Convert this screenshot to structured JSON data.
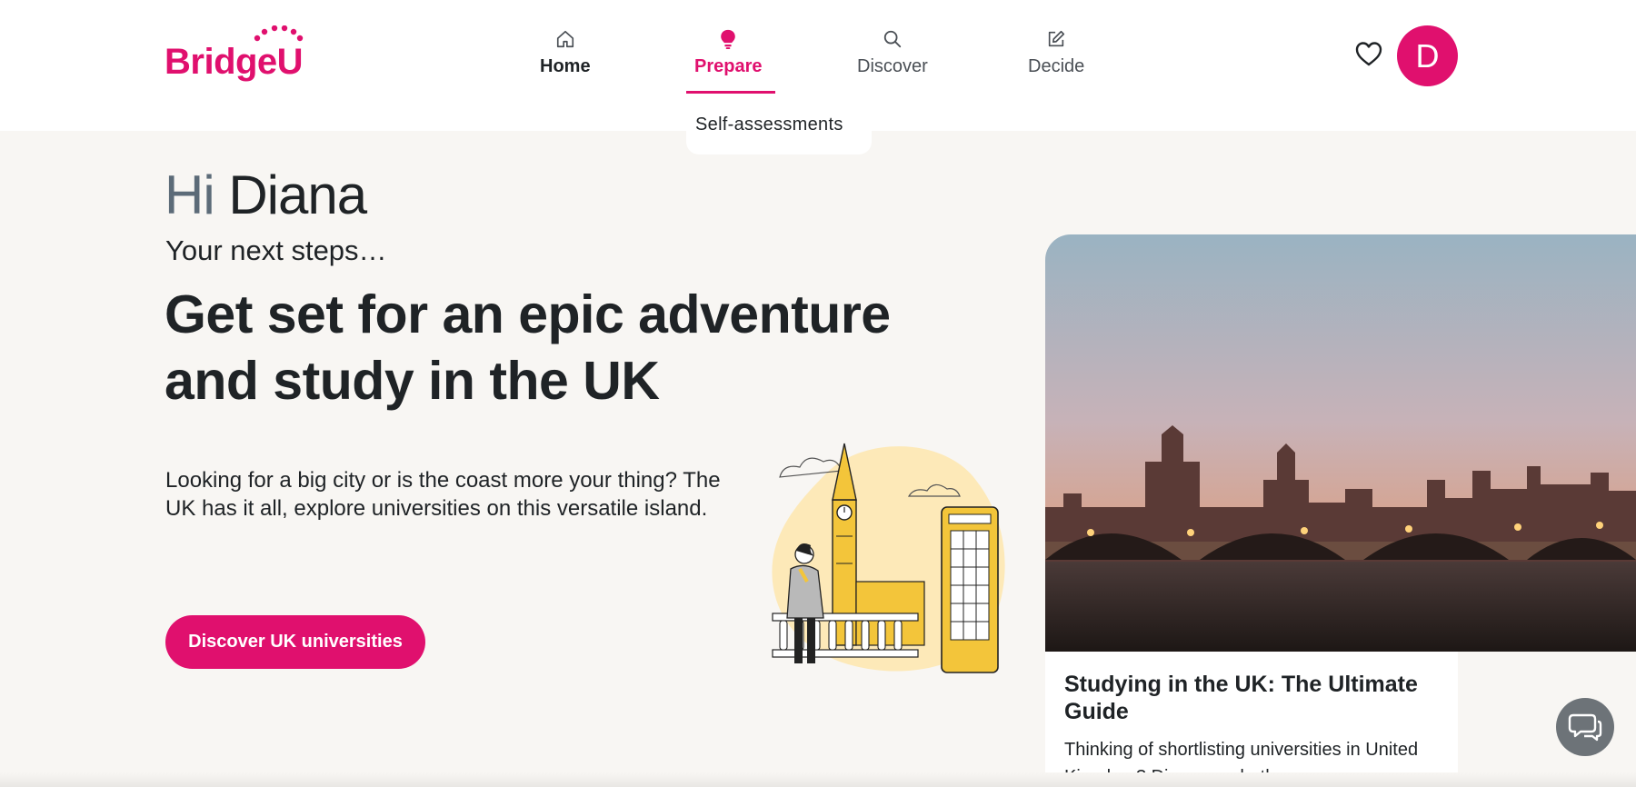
{
  "brand": {
    "name": "BridgeU",
    "color": "#e0106e"
  },
  "nav": {
    "items": [
      {
        "label": "Home",
        "icon": "home-icon"
      },
      {
        "label": "Prepare",
        "icon": "lightbulb-icon"
      },
      {
        "label": "Discover",
        "icon": "search-icon"
      },
      {
        "label": "Decide",
        "icon": "edit-icon"
      }
    ],
    "active_item": "Prepare",
    "dropdown_item": "Self-assessments"
  },
  "user": {
    "avatar_initial": "D",
    "favorites_icon": "heart-icon"
  },
  "hero": {
    "greeting_hi": "Hi",
    "greeting_name": "Diana",
    "subheading": "Your next steps…",
    "headline": "Get set for an epic adventure and study in the UK",
    "body": "Looking for a big city or is the coast more your thing? The UK has it all, explore universities on this versatile island.",
    "cta_label": "Discover UK universities"
  },
  "card": {
    "title": "Studying in the UK: The Ultimate Guide",
    "description": "Thinking of shortlisting universities in United Kingdom? Discover whether or"
  },
  "chat": {
    "icon": "chat-bubbles-icon"
  }
}
